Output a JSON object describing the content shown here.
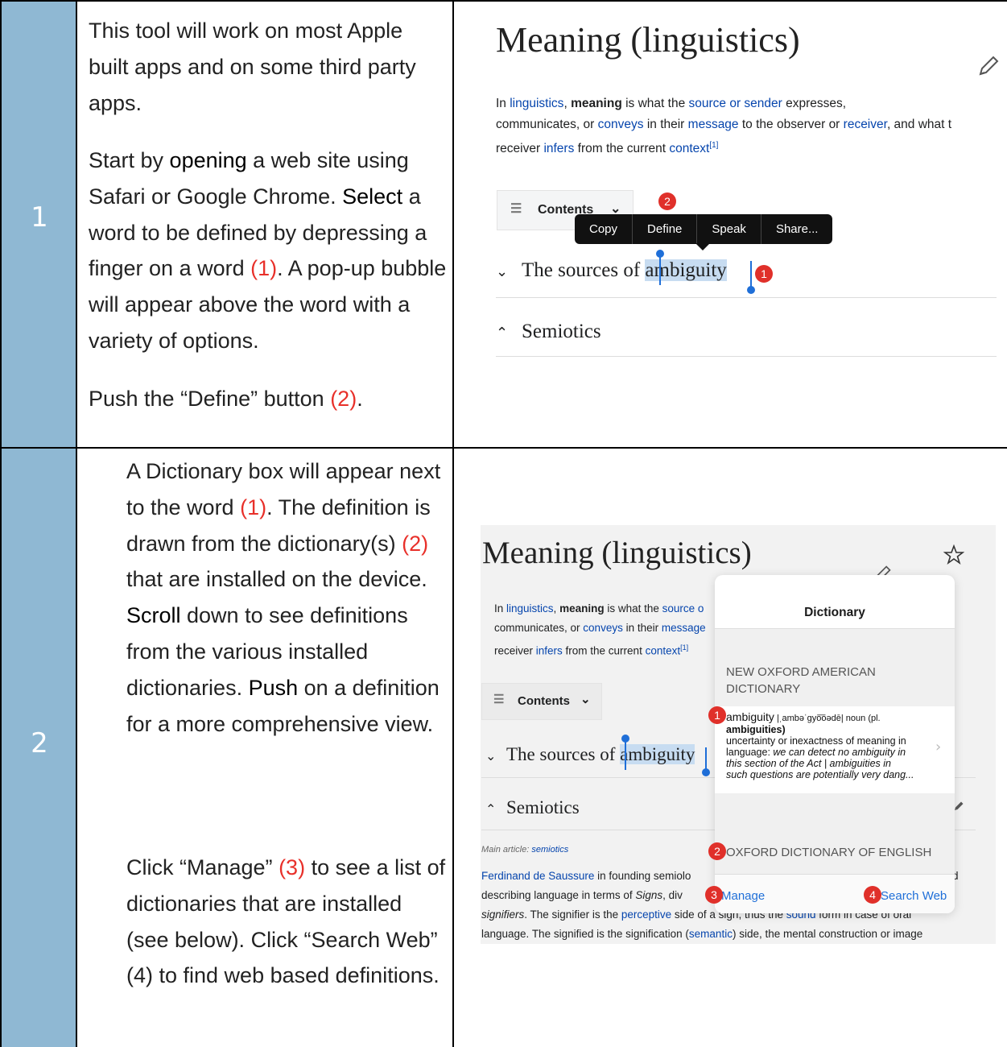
{
  "rows": [
    {
      "number": "1",
      "paragraphs": {
        "p1": "This tool will work on most Apple built apps and on some third party apps.",
        "p2a": "Start by ",
        "p2b": "opening",
        "p2c": " a web site using Safari or Google Chrome.  ",
        "p2d": "Select",
        "p2e": " a word to be defined by depressing a finger on a word ",
        "p2f": "(1)",
        "p2g": ".  A pop-up bubble will appear above the word with a variety of options.",
        "p3a": "Push the “Define” button ",
        "p3b": "(2)",
        "p3c": "."
      },
      "screenshot": {
        "title": "Meaning (linguistics)",
        "body": {
          "t1": "In ",
          "l1": "linguistics",
          "t2": ", ",
          "b1": "meaning",
          "t3": " is what the ",
          "l2": "source or sender",
          "t4": " expresses,",
          "t5": "communicates, or ",
          "l3": "conveys",
          "t6": " in their ",
          "l4": "message",
          "t7": " to the observer or ",
          "l5": "receiver",
          "t8": ", and what t",
          "t9": "receiver ",
          "l6": "infers",
          "t10": " from the current ",
          "l7": "context",
          "sup": "[1]"
        },
        "contents_label": "Contents",
        "popup": [
          "Copy",
          "Define",
          "Speak",
          "Share..."
        ],
        "section1_prefix": "The sources of ",
        "section1_word": "ambiguity",
        "section2": "Semiotics",
        "badge1": "1",
        "badge2": "2"
      }
    },
    {
      "number": "2",
      "paragraphs": {
        "p1a": "A Dictionary box will appear next to the word ",
        "p1b": "(1)",
        "p1c": ".  The definition is drawn from the dictionary(s) ",
        "p1d": "(2)",
        "p1e": " that are installed on the device.  ",
        "p1f": "Scroll",
        "p1g": " down to see definitions from the various installed dictionaries.  ",
        "p1h": "Push",
        "p1i": " on a definition for a more comprehensive view.",
        "p2a": "Click “Manage” ",
        "p2b": "(3)",
        "p2c": " to see a list of dictionaries that are installed (see below). Click “Search Web” (4) to find web based definitions."
      },
      "screenshot": {
        "title": "Meaning (linguistics)",
        "line1a": "In ",
        "line1b": "linguistics",
        "line1c": ", ",
        "line1d": "meaning",
        "line1e": " is what the ",
        "line1f": "source o",
        "line2a": "communicates, or ",
        "line2b": "conveys",
        "line2c": " in their ",
        "line2d": "message",
        "line3a": "receiver ",
        "line3b": "infers",
        "line3c": " from the current ",
        "line3d": "context",
        "line3sup": "[1]",
        "contents_label": "Contents",
        "section1_prefix": "The sources of ",
        "section1_word": "ambiguity",
        "section2": "Semiotics",
        "main_article_label": "Main article: ",
        "main_article_link": "semiotics",
        "para_a": "Ferdinand de Saussure",
        "para_b": " in founding semiolo",
        "para_c": "d",
        "para_d": "describing language in terms of ",
        "para_e": "Signs",
        "para_f": ", div",
        "para_g": "signifiers",
        "para_h": ". The signifier is the ",
        "para_i": "perceptive",
        "para_j": " side of a sign, thus the ",
        "para_k": "sound",
        "para_l": " form in case of oral",
        "para_m": "language. The signified is the signification (",
        "para_n": "semantic",
        "para_o": ") side, the mental construction or image",
        "dictionary": {
          "header": "Dictionary",
          "source1": "NEW OXFORD AMERICAN DICTIONARY",
          "entry_word": "ambiguity",
          "entry_pron": " |ˌambəˈgyo͞oədē| noun (pl.",
          "entry_plural": "ambiguities)",
          "entry_def1": "uncertainty or inexactness of meaning in",
          "entry_def2": "language: ",
          "entry_ex1": "we can detect no ambiguity in",
          "entry_ex2": "this section of the Act | ambiguities in",
          "entry_ex3": "such questions are potentially very dang...",
          "source2": "OXFORD DICTIONARY OF ENGLISH",
          "manage": "Manage",
          "search_web": "Search Web"
        },
        "badges": [
          "1",
          "2",
          "3",
          "4"
        ]
      }
    }
  ],
  "colors": {
    "number_cell": "#8fb8d3",
    "annotation_red": "#e8302a",
    "link_blue": "#0645ad",
    "ios_blue": "#1f6fd8"
  }
}
